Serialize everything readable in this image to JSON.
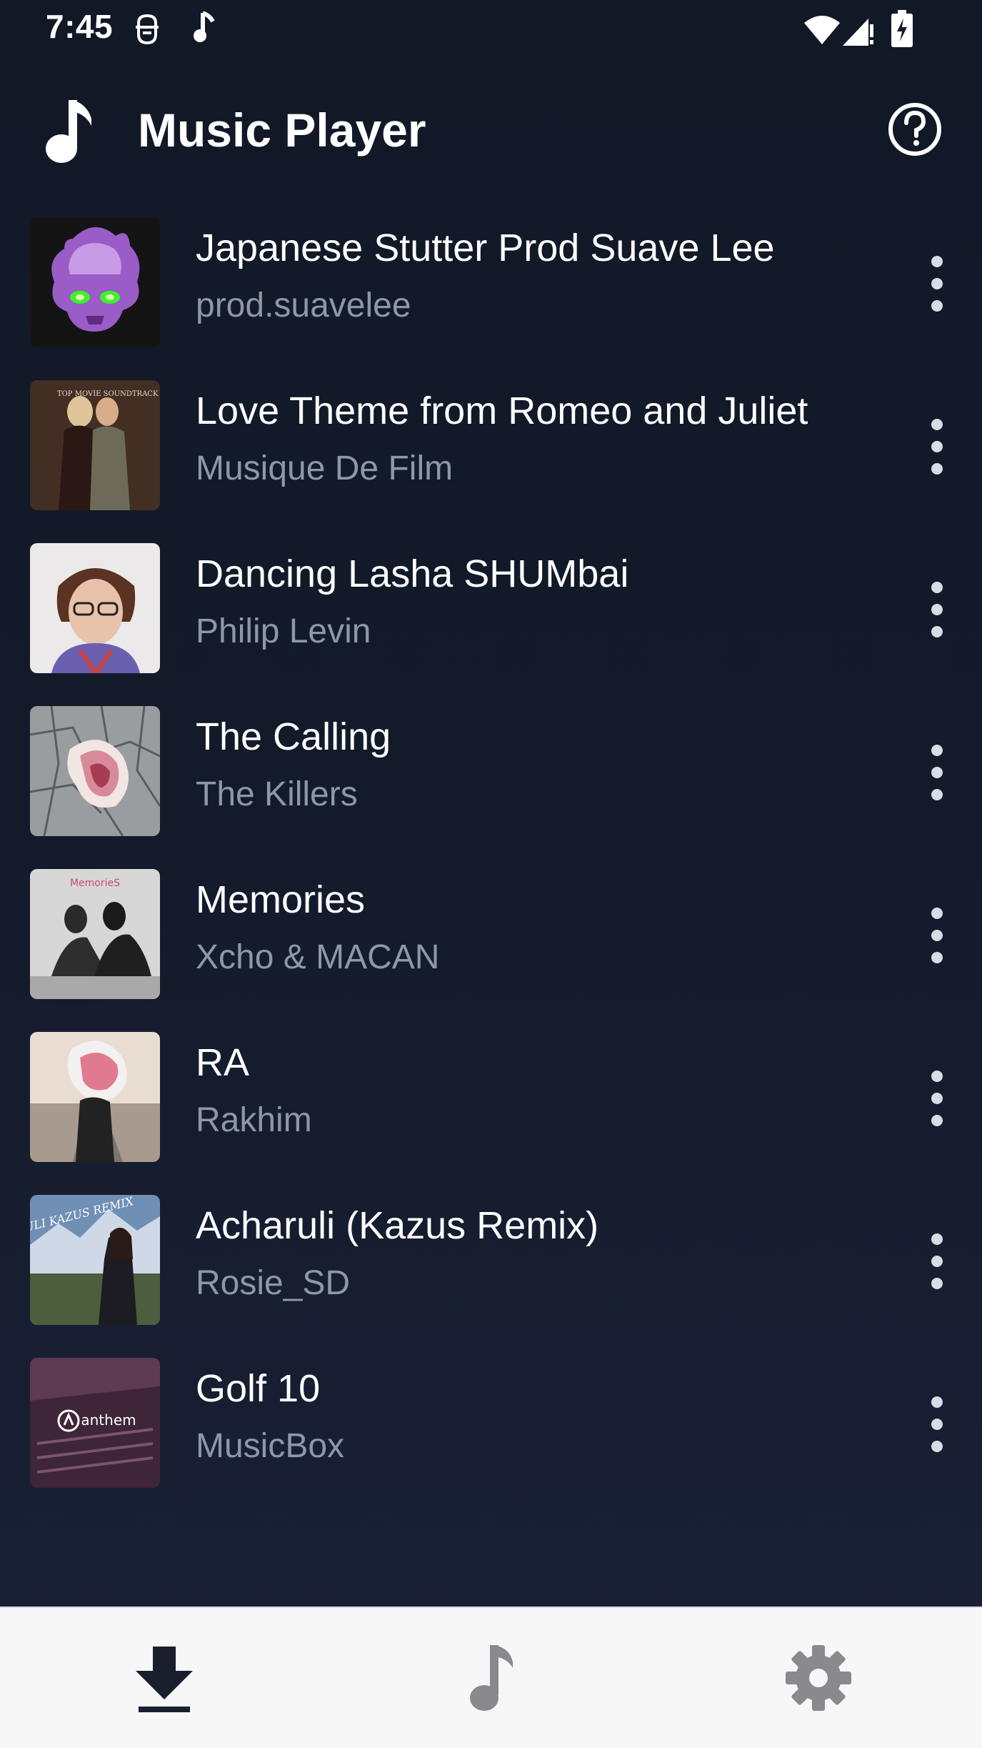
{
  "status_bar": {
    "time": "7:45",
    "icons_left": [
      "accessibility-icon",
      "music-note-icon"
    ],
    "icons_right": [
      "wifi-icon",
      "cell-signal-icon",
      "battery-charging-icon"
    ]
  },
  "header": {
    "title": "Music Player",
    "logo_icon": "music-note-icon",
    "help_icon": "help-circle-icon"
  },
  "songs": [
    {
      "title": "Japanese Stutter Prod Suave Lee",
      "artist": "prod.suavelee"
    },
    {
      "title": "Love Theme from Romeo and Juliet",
      "artist": "Musique De Film"
    },
    {
      "title": "Dancing Lasha SHUMbai",
      "artist": "Philip Levin"
    },
    {
      "title": "The Calling",
      "artist": "The Killers"
    },
    {
      "title": "Memories",
      "artist": "Xcho & MACAN"
    },
    {
      "title": "RA",
      "artist": "Rakhim"
    },
    {
      "title": "Acharuli (Kazus Remix)",
      "artist": "Rosie_SD"
    },
    {
      "title": "Golf 10",
      "artist": "MusicBox"
    }
  ],
  "cover_text": {
    "romeo": "TOP MOVIE SOUNDTRACK LOVE THEMES",
    "memories": "MemorieS",
    "acharuli": "ACHARULI KAZUS REMIX",
    "anthem": "anthem"
  },
  "bottom_nav": {
    "items": [
      {
        "icon": "download-icon",
        "active": true
      },
      {
        "icon": "music-note-icon",
        "active": false
      },
      {
        "icon": "settings-gear-icon",
        "active": false
      }
    ]
  },
  "colors": {
    "background": "#131a2a",
    "text_primary": "#ffffff",
    "text_secondary": "#8e97a9",
    "nav_background": "#f7f7f8",
    "nav_active": "#1a1f2e",
    "nav_inactive": "#8a8a8e"
  }
}
